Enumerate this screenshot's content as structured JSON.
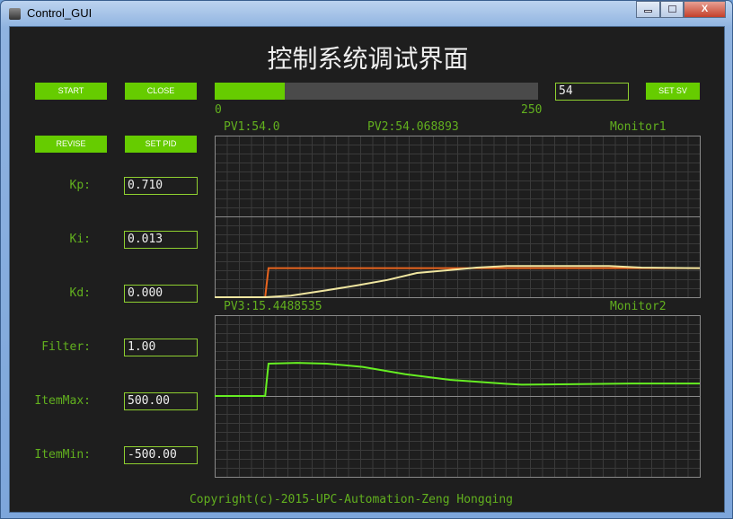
{
  "window": {
    "title": "Control_GUI",
    "controls": [
      "minimize",
      "maximize",
      "close"
    ],
    "close_glyph": "X"
  },
  "header": {
    "title": "控制系统调试界面"
  },
  "buttons": {
    "start": "START",
    "close": "CLOSE",
    "revise": "REVISE",
    "set_pid": "SET PID",
    "set_sv": "SET SV"
  },
  "progress": {
    "value": 54,
    "min": 0,
    "max": 250,
    "min_label": "0",
    "max_label": "250",
    "fill_color": "#66cc00"
  },
  "sv_input": {
    "value": "54"
  },
  "params": [
    {
      "label": "Kp:",
      "value": "0.710"
    },
    {
      "label": "Ki:",
      "value": "0.013"
    },
    {
      "label": "Kd:",
      "value": "0.000"
    },
    {
      "label": "Filter:",
      "value": "1.00"
    },
    {
      "label": "ItemMax:",
      "value": "500.00"
    },
    {
      "label": "ItemMin:",
      "value": "-500.00"
    }
  ],
  "monitor1": {
    "name": "Monitor1",
    "pv1": "PV1:54.0",
    "pv2": "PV2:54.068893"
  },
  "monitor2": {
    "name": "Monitor2",
    "pv3": "PV3:15.4488535"
  },
  "footer": {
    "copyright": "Copyright(c)-2015-UPC-Automation-Zeng Hongqing"
  },
  "chart_data": [
    {
      "type": "line",
      "name": "Monitor1",
      "ylim": [
        0,
        300
      ],
      "xlim": [
        0,
        100
      ],
      "grid": true,
      "series": [
        {
          "color": "#e8641e",
          "x": [
            0,
            10.4,
            11.1,
            100
          ],
          "y": [
            0,
            0,
            54,
            54
          ]
        },
        {
          "color": "#f0e6a0",
          "x": [
            0,
            10.4,
            15.7,
            23.1,
            29.4,
            35.6,
            41.7,
            48,
            54,
            60.2,
            81.3,
            88,
            100
          ],
          "y": [
            0,
            0,
            3,
            13,
            22,
            32,
            45,
            50,
            55,
            58,
            58,
            55,
            54.07
          ]
        }
      ]
    },
    {
      "type": "line",
      "name": "Monitor2",
      "ylim": [
        -100,
        100
      ],
      "xlim": [
        0,
        100
      ],
      "grid": true,
      "series": [
        {
          "color": "#66ee22",
          "x": [
            0,
            10.4,
            11.1,
            17,
            23.1,
            30.5,
            39.3,
            48.5,
            60.2,
            63.3,
            86,
            100
          ],
          "y": [
            0,
            0,
            40,
            41,
            40,
            36,
            27,
            20,
            15,
            14,
            15.4,
            15.45
          ]
        }
      ]
    }
  ]
}
